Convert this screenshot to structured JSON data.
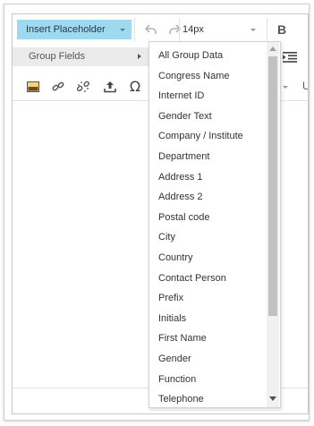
{
  "toolbar": {
    "insert_placeholder_label": "Insert Placeholder",
    "font_size_value": "14px",
    "bold_label": "B",
    "icons": [
      "undo-icon",
      "redo-icon",
      "indent-icon",
      "image-icon",
      "link-icon",
      "unlink-icon",
      "upload-icon",
      "special-character-icon"
    ]
  },
  "submenu": {
    "label": "Group Fields"
  },
  "row3": {
    "special_char": "Ω",
    "underline_label": "U"
  },
  "dropdown": {
    "items": [
      "All Group Data",
      "Congress Name",
      "Internet ID",
      "Gender Text",
      "Company / Institute",
      "Department",
      "Address 1",
      "Address 2",
      "Postal code",
      "City",
      "Country",
      "Contact Person",
      "Prefix",
      "Initials",
      "First Name",
      "Gender",
      "Function",
      "Telephone"
    ]
  },
  "colors": {
    "insert_button_bg": "#9fd9ef",
    "submenu_bg": "#ebebeb",
    "scroll_thumb": "#c1c1c1"
  }
}
